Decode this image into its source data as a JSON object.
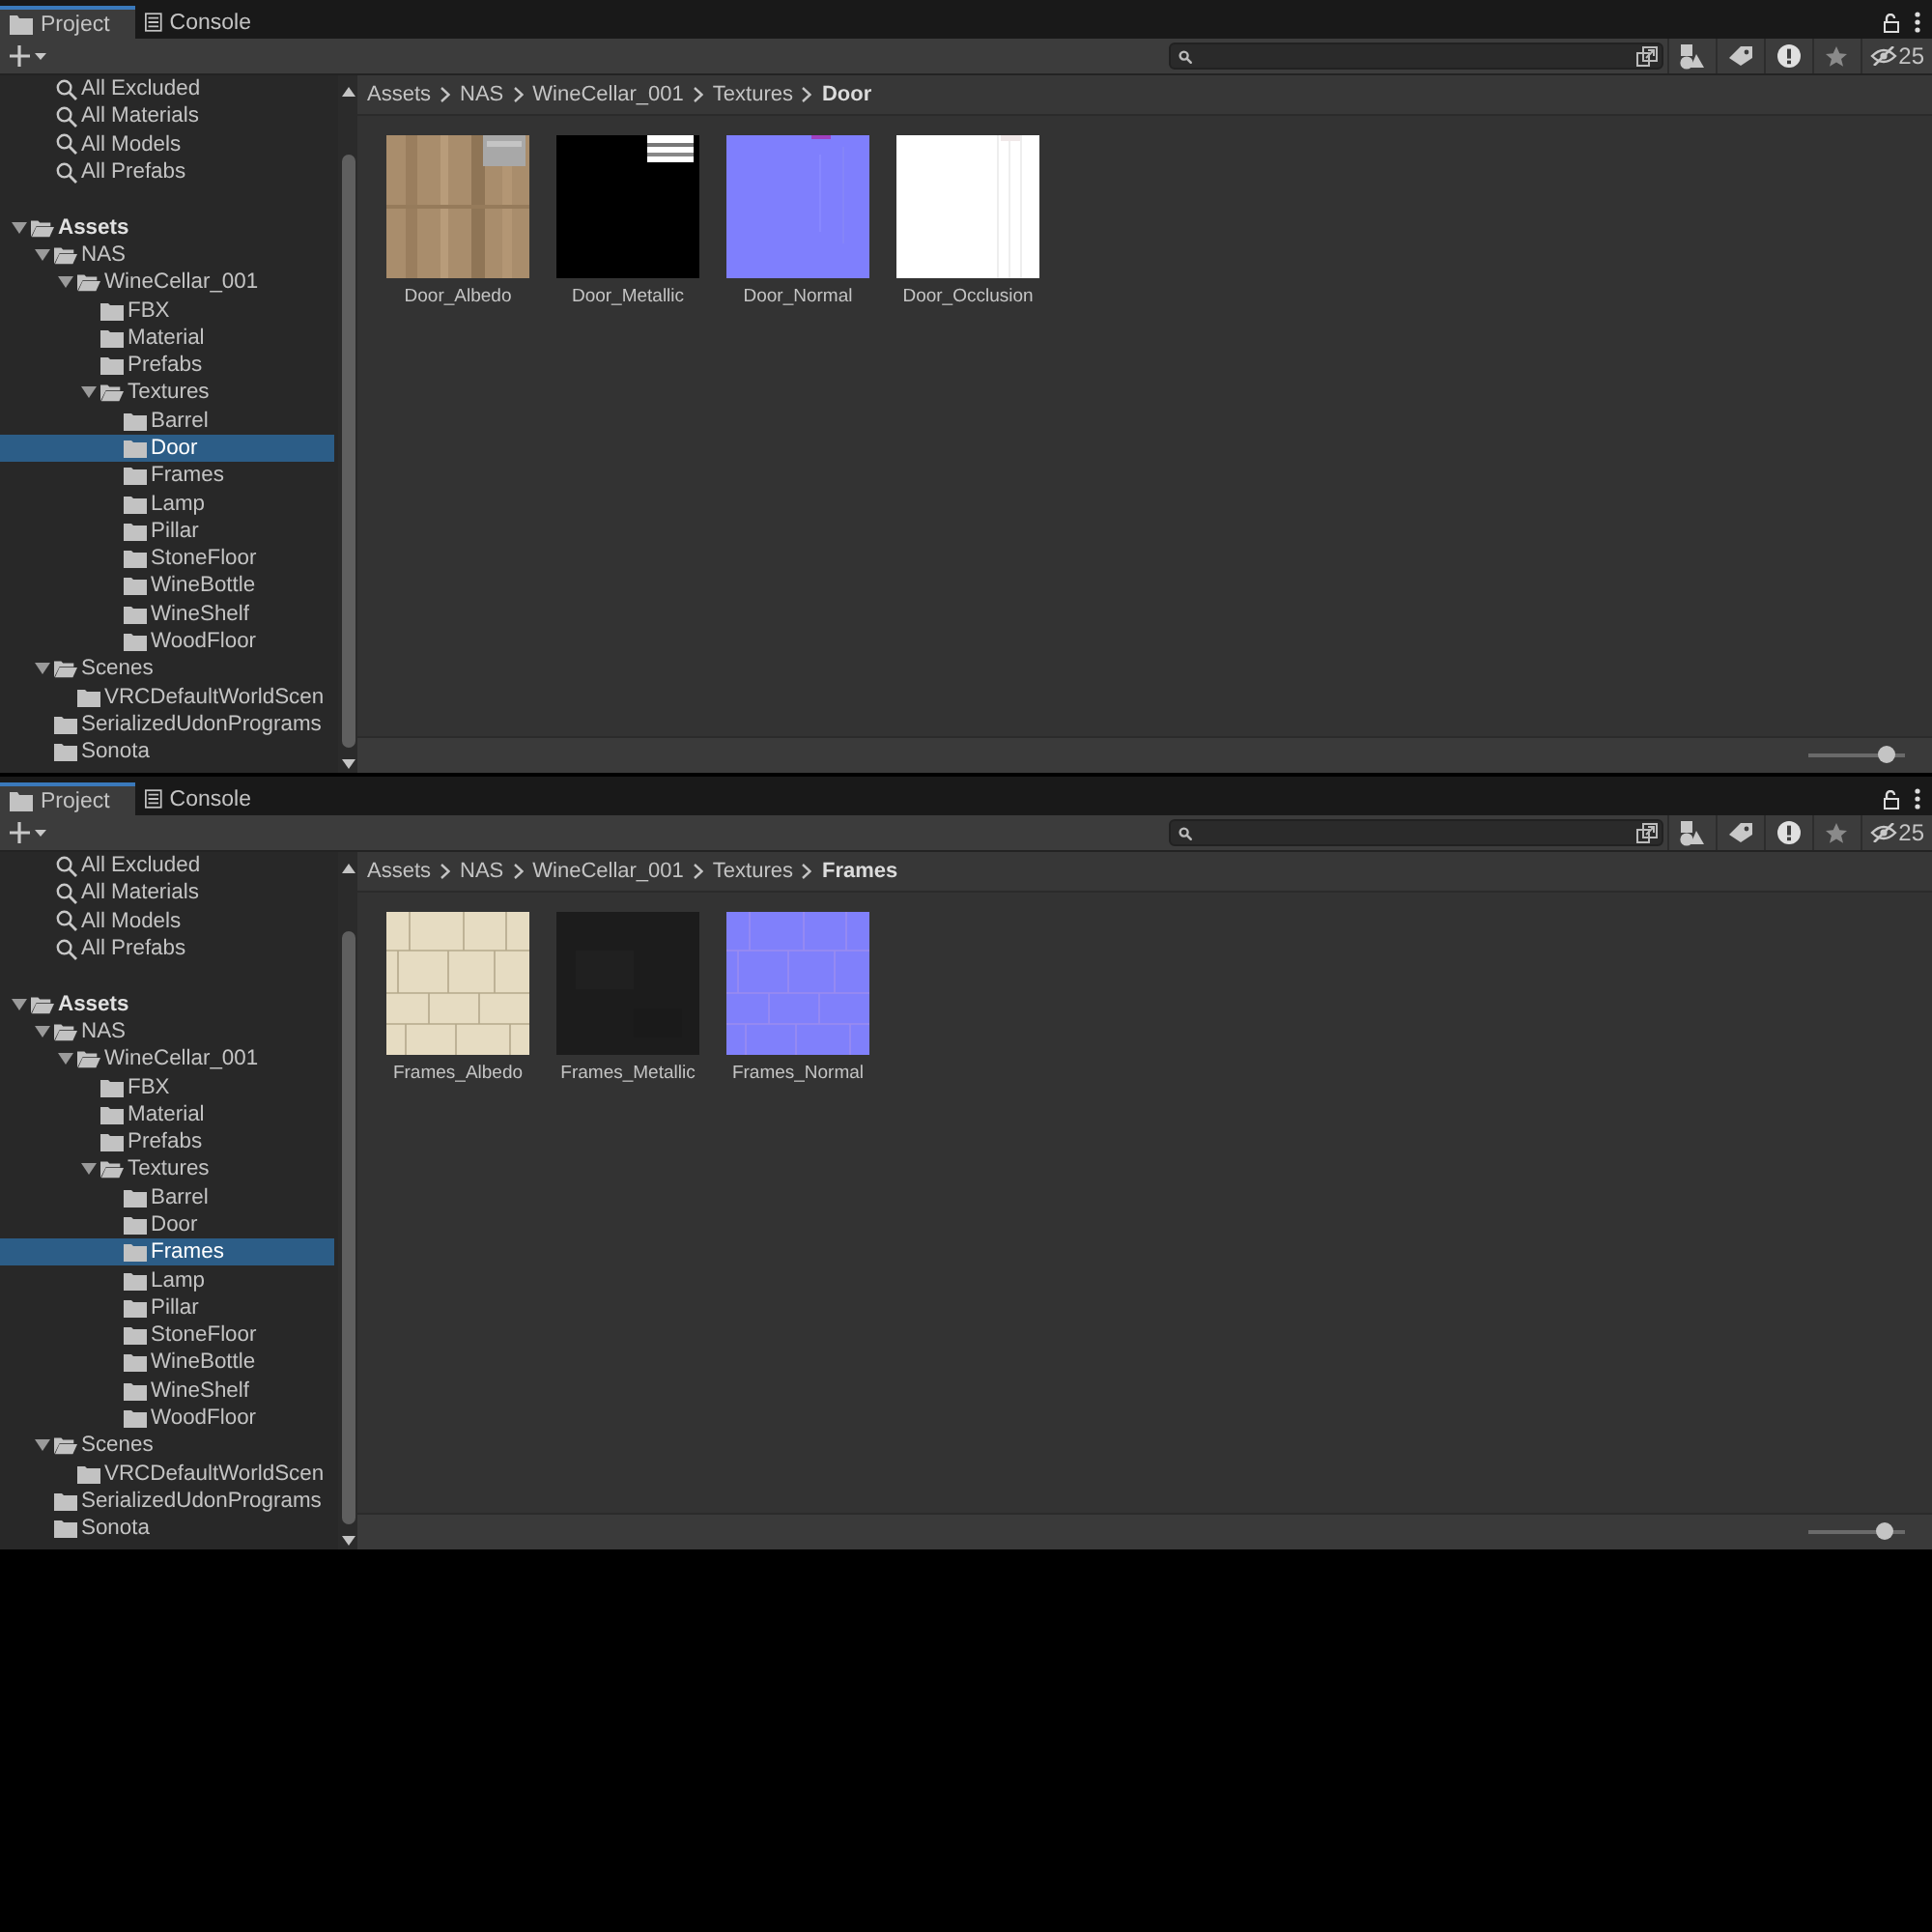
{
  "panels": [
    {
      "tabs": [
        {
          "label": "Project",
          "kind": "folder",
          "selected": true
        },
        {
          "label": "Console",
          "kind": "console",
          "selected": false
        }
      ],
      "toolbar": {
        "hidden_count": "25"
      },
      "favorites": [
        {
          "label": "All Excluded"
        },
        {
          "label": "All Materials"
        },
        {
          "label": "All Models"
        },
        {
          "label": "All Prefabs"
        }
      ],
      "tree": [
        {
          "label": "Assets",
          "expanded": true,
          "selected": false,
          "children": [
            {
              "label": "NAS",
              "expanded": true,
              "selected": false,
              "children": [
                {
                  "label": "WineCellar_001",
                  "expanded": true,
                  "selected": false,
                  "children": [
                    {
                      "label": "FBX",
                      "selected": false
                    },
                    {
                      "label": "Material",
                      "selected": false
                    },
                    {
                      "label": "Prefabs",
                      "selected": false
                    },
                    {
                      "label": "Textures",
                      "expanded": true,
                      "selected": false,
                      "children": [
                        {
                          "label": "Barrel",
                          "selected": false
                        },
                        {
                          "label": "Door",
                          "selected": true
                        },
                        {
                          "label": "Frames",
                          "selected": false
                        },
                        {
                          "label": "Lamp",
                          "selected": false
                        },
                        {
                          "label": "Pillar",
                          "selected": false
                        },
                        {
                          "label": "StoneFloor",
                          "selected": false
                        },
                        {
                          "label": "WineBottle",
                          "selected": false
                        },
                        {
                          "label": "WineShelf",
                          "selected": false
                        },
                        {
                          "label": "WoodFloor",
                          "selected": false
                        }
                      ]
                    }
                  ]
                }
              ]
            },
            {
              "label": "Scenes",
              "expanded": true,
              "selected": false,
              "children": [
                {
                  "label": "VRCDefaultWorldScen",
                  "selected": false
                }
              ]
            },
            {
              "label": "SerializedUdonPrograms",
              "selected": false
            },
            {
              "label": "Sonota",
              "selected": false
            }
          ]
        }
      ],
      "breadcrumb": [
        "Assets",
        "NAS",
        "WineCellar_001",
        "Textures",
        "Door"
      ],
      "assets": [
        {
          "name": "Door_Albedo",
          "kind": "wood"
        },
        {
          "name": "Door_Metallic",
          "kind": "black"
        },
        {
          "name": "Door_Normal",
          "kind": "normal"
        },
        {
          "name": "Door_Occlusion",
          "kind": "white"
        }
      ],
      "thumbnail_size": {
        "level": 0.8
      }
    },
    {
      "tabs": [
        {
          "label": "Project",
          "kind": "folder",
          "selected": true
        },
        {
          "label": "Console",
          "kind": "console",
          "selected": false
        }
      ],
      "toolbar": {
        "hidden_count": "25"
      },
      "favorites": [
        {
          "label": "All Excluded"
        },
        {
          "label": "All Materials"
        },
        {
          "label": "All Models"
        },
        {
          "label": "All Prefabs"
        }
      ],
      "tree": [
        {
          "label": "Assets",
          "expanded": true,
          "selected": false,
          "children": [
            {
              "label": "NAS",
              "expanded": true,
              "selected": false,
              "children": [
                {
                  "label": "WineCellar_001",
                  "expanded": true,
                  "selected": false,
                  "children": [
                    {
                      "label": "FBX",
                      "selected": false
                    },
                    {
                      "label": "Material",
                      "selected": false
                    },
                    {
                      "label": "Prefabs",
                      "selected": false
                    },
                    {
                      "label": "Textures",
                      "expanded": true,
                      "selected": false,
                      "children": [
                        {
                          "label": "Barrel",
                          "selected": false
                        },
                        {
                          "label": "Door",
                          "selected": false
                        },
                        {
                          "label": "Frames",
                          "selected": true
                        },
                        {
                          "label": "Lamp",
                          "selected": false
                        },
                        {
                          "label": "Pillar",
                          "selected": false
                        },
                        {
                          "label": "StoneFloor",
                          "selected": false
                        },
                        {
                          "label": "WineBottle",
                          "selected": false
                        },
                        {
                          "label": "WineShelf",
                          "selected": false
                        },
                        {
                          "label": "WoodFloor",
                          "selected": false
                        }
                      ]
                    }
                  ]
                }
              ]
            },
            {
              "label": "Scenes",
              "expanded": true,
              "selected": false,
              "children": [
                {
                  "label": "VRCDefaultWorldScen",
                  "selected": false
                }
              ]
            },
            {
              "label": "SerializedUdonPrograms",
              "selected": false
            },
            {
              "label": "Sonota",
              "selected": false
            }
          ]
        }
      ],
      "breadcrumb": [
        "Assets",
        "NAS",
        "WineCellar_001",
        "Textures",
        "Frames"
      ],
      "assets": [
        {
          "name": "Frames_Albedo",
          "kind": "stone"
        },
        {
          "name": "Frames_Metallic",
          "kind": "dark"
        },
        {
          "name": "Frames_Normal",
          "kind": "normal-bricks"
        }
      ],
      "thumbnail_size": {
        "level": 0.78
      }
    }
  ]
}
